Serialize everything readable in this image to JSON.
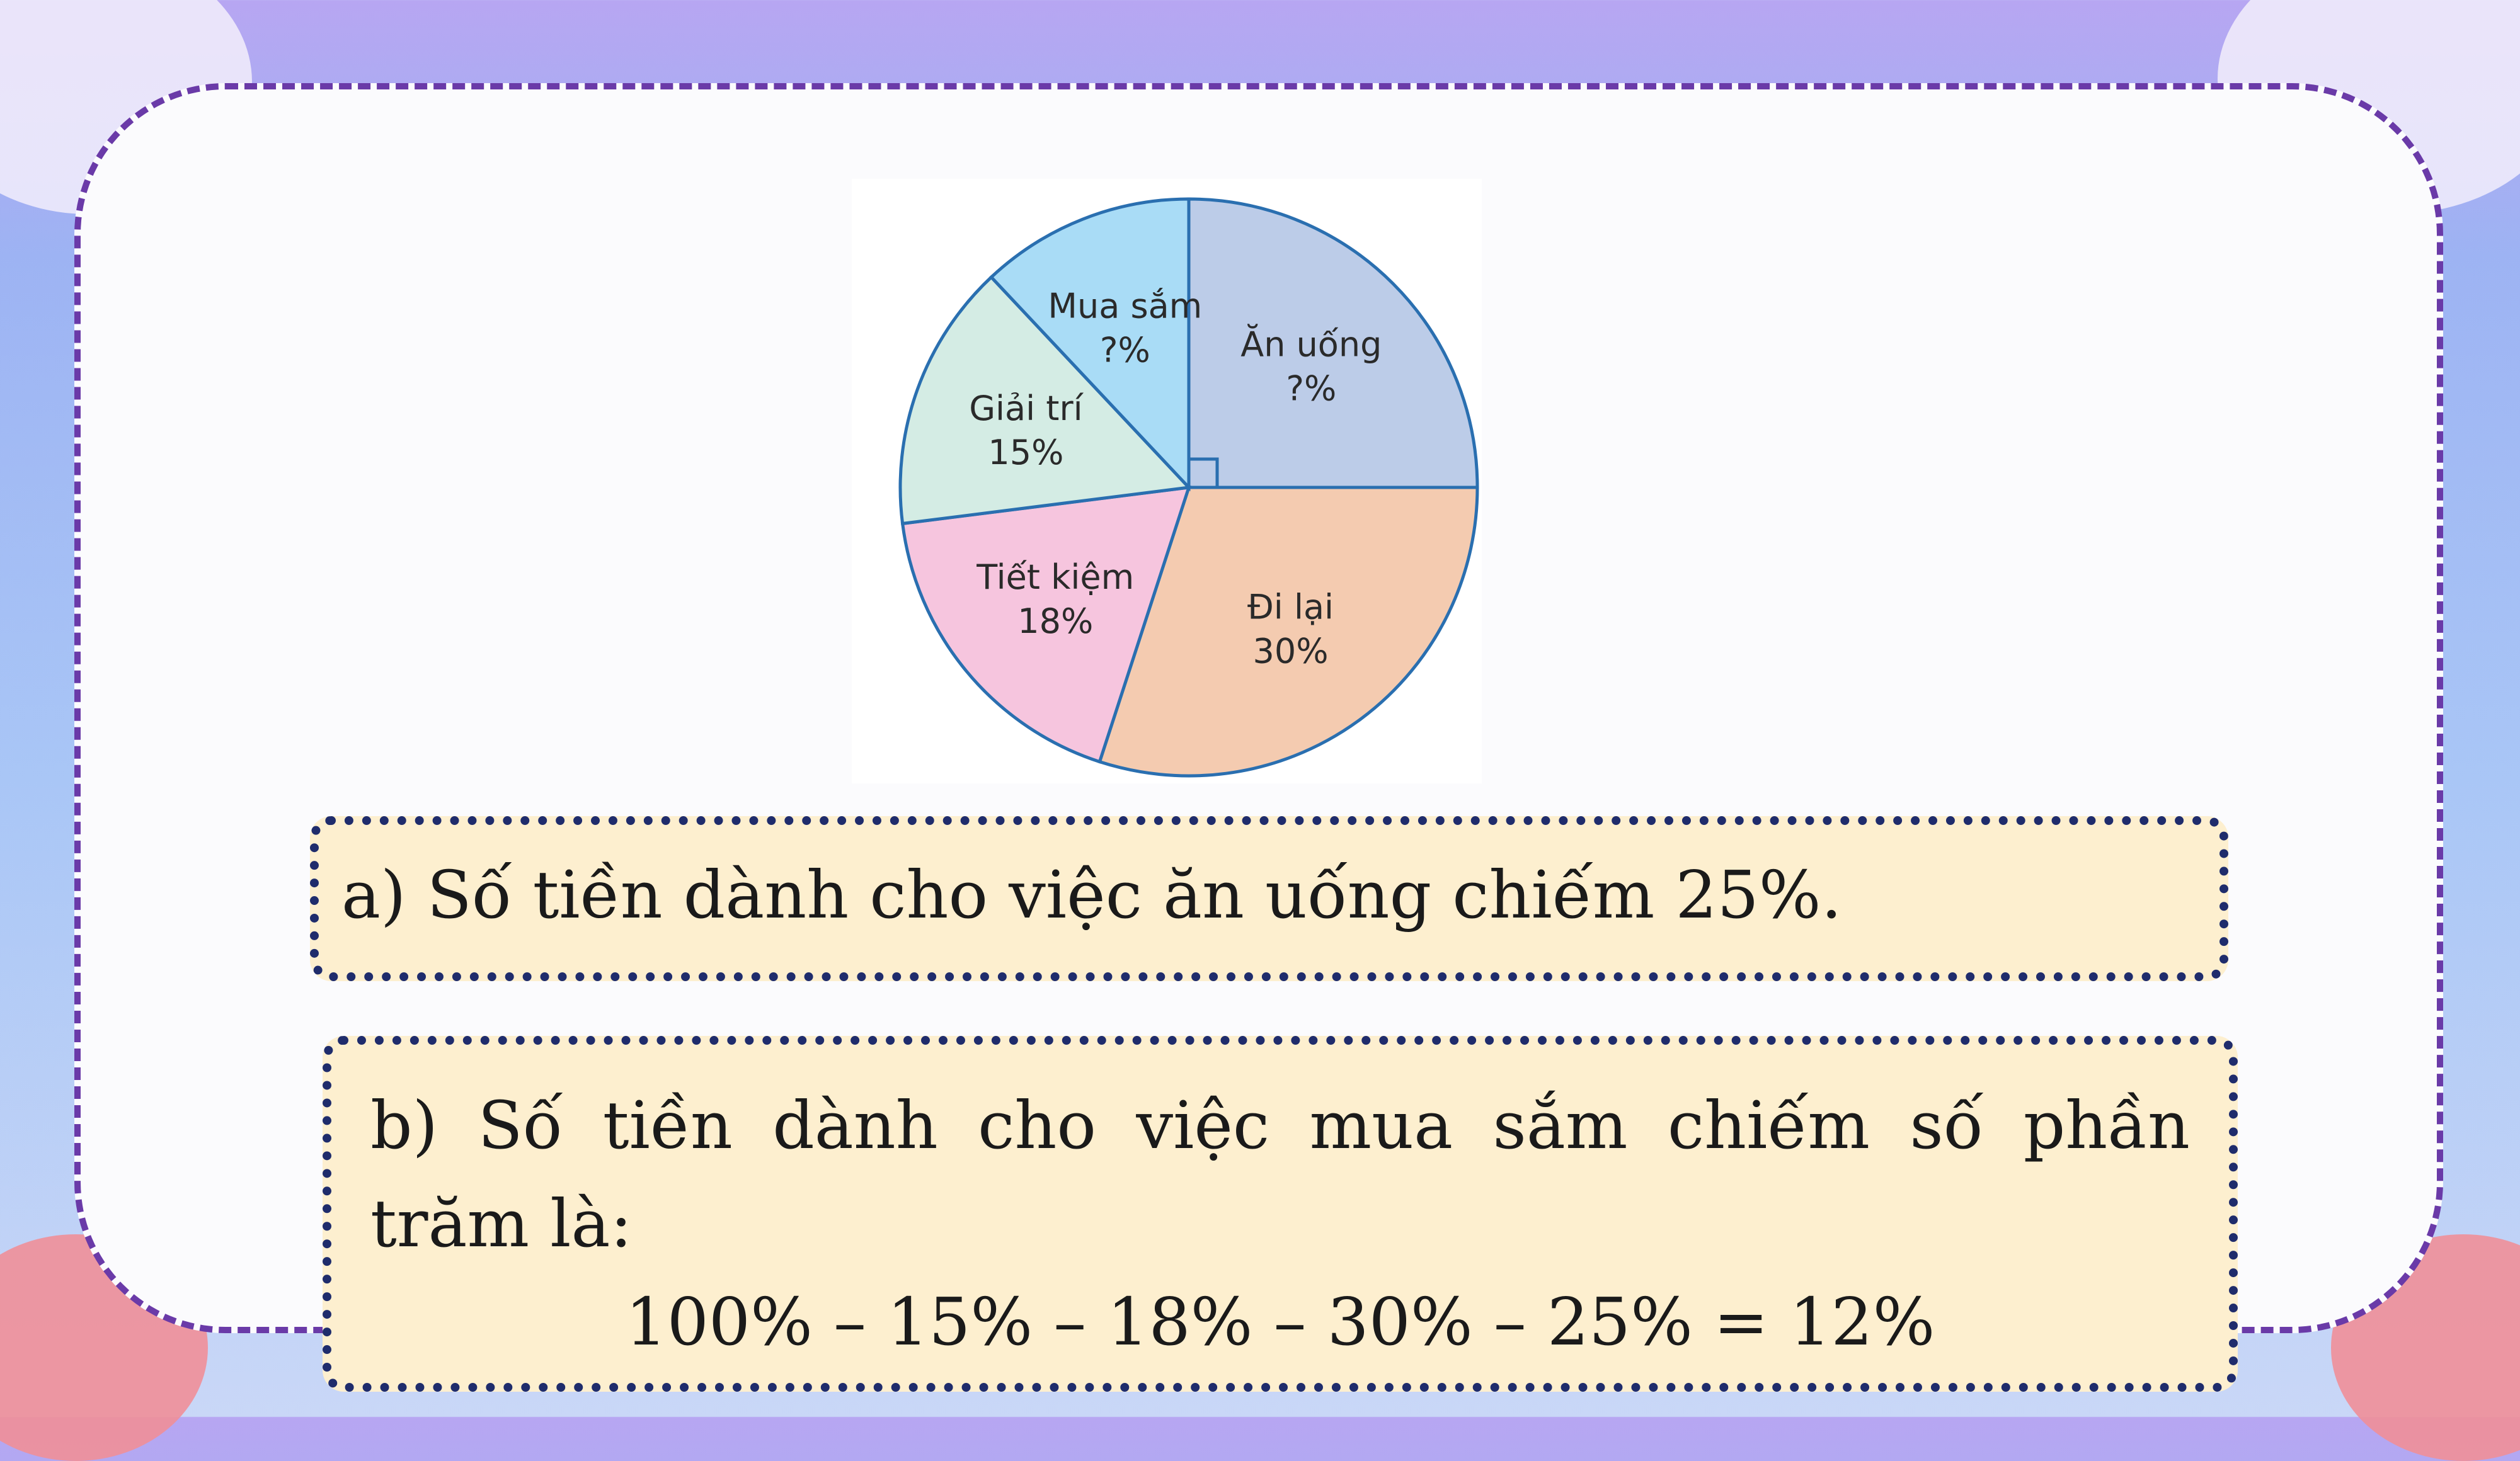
{
  "chart_data": {
    "type": "pie",
    "slices": [
      {
        "label": "Ăn uống",
        "value_text": "?%",
        "value": 25,
        "color": "#bccce8"
      },
      {
        "label": "Đi lại",
        "value_text": "30%",
        "value": 30,
        "color": "#f4cbb0"
      },
      {
        "label": "Tiết kiệm",
        "value_text": "18%",
        "value": 18,
        "color": "#f6c5de"
      },
      {
        "label": "Giải trí",
        "value_text": "15%",
        "value": 15,
        "color": "#d4ece4"
      },
      {
        "label": "Mua sắm",
        "value_text": "?%",
        "value": 12,
        "color": "#a9dcf6"
      }
    ],
    "edge_color": "#2a6fb0",
    "start": "12 o'clock, clockwise",
    "right_angle_marker": true
  },
  "answers": {
    "a": "a) Số tiền dành cho việc ăn uống chiếm 25%.",
    "b_line1": "b) Số tiền dành cho việc mua sắm chiếm số phần",
    "b_line2": "trăm là:",
    "b_formula": "100% – 15% – 18% – 30% – 25% = 12%"
  },
  "colors": {
    "panel_border": "#6a3aa8",
    "answer_bg": "#fdefcf",
    "answer_border": "#1f2c6c"
  }
}
